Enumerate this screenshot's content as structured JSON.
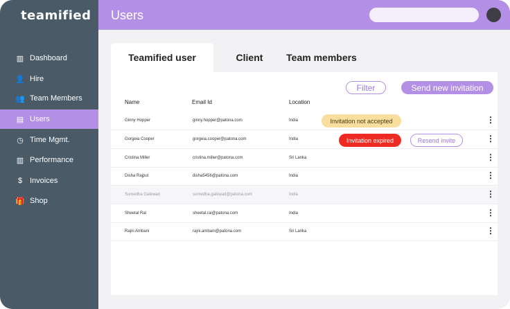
{
  "app": {
    "logo": "teamified"
  },
  "sidebar": {
    "items": [
      {
        "icon": "bar-chart-icon",
        "glyph": "▥",
        "label": "Dashboard"
      },
      {
        "icon": "add-user-icon",
        "glyph": "👤",
        "label": "Hire"
      },
      {
        "icon": "users-icon",
        "glyph": "👥",
        "label": "Team Members"
      },
      {
        "icon": "user-card-icon",
        "glyph": "▤",
        "label": "Users"
      },
      {
        "icon": "clock-icon",
        "glyph": "◷",
        "label": "Time Mgmt."
      },
      {
        "icon": "bar-chart-icon",
        "glyph": "▥",
        "label": "Performance"
      },
      {
        "icon": "dollar-icon",
        "glyph": "$",
        "label": "Invoices"
      },
      {
        "icon": "gift-icon",
        "glyph": "🎁",
        "label": "Shop"
      }
    ],
    "active_index": 3
  },
  "header": {
    "title": "Users"
  },
  "tabs": [
    {
      "label": "Teamified user",
      "active": true
    },
    {
      "label": "Client",
      "active": false
    },
    {
      "label": "Team members",
      "active": false
    }
  ],
  "toolbar": {
    "filter_label": "Filter",
    "invite_label": "Send new invitation"
  },
  "table": {
    "headers": [
      "Name",
      "Email Id",
      "Location"
    ],
    "rows": [
      {
        "name": "Ginny Hopper",
        "email": "ginny.hopper@patona.com",
        "location": "India",
        "status": "Invitation not accepted",
        "status_kind": "warn"
      },
      {
        "name": "Gorgeia Cooper",
        "email": "gorgeia.cooper@patona.com",
        "location": "India",
        "status": "Invitation expired",
        "status_kind": "err",
        "action": "Resend invite"
      },
      {
        "name": "Cristina Miller",
        "email": "cristina.miller@patona.com",
        "location": "Sri Lanka"
      },
      {
        "name": "Disha Rajput",
        "email": "disha5456@patona.com",
        "location": "India"
      },
      {
        "name": "Sumedha Gaikwad",
        "email": "sumedha.gaikwad@patona.com",
        "location": "India",
        "dimmed": true
      },
      {
        "name": "Sheetal Rai",
        "email": "sheetal.rai@patona.com",
        "location": "India"
      },
      {
        "name": "Rajni Ambani",
        "email": "rajni.ambani@patona.com",
        "location": "Sri Lanka"
      }
    ]
  },
  "colors": {
    "accent": "#b390e6",
    "sidebar": "#4a5a67",
    "warning": "#f9dea0",
    "error": "#ee2b22"
  }
}
